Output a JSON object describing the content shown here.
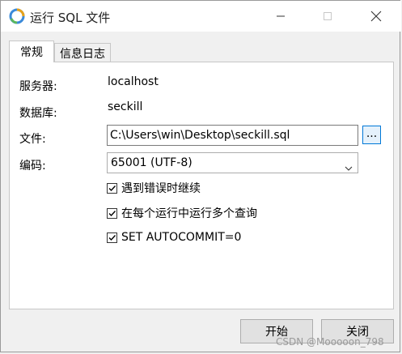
{
  "window": {
    "title": "运行 SQL 文件",
    "icons": {
      "app": "navicat-app-icon",
      "minimize": "minimize-icon",
      "maximize": "maximize-icon",
      "close": "close-icon"
    }
  },
  "tabs": [
    {
      "label": "常规",
      "active": true
    },
    {
      "label": "信息日志",
      "active": false
    }
  ],
  "general": {
    "server_label": "服务器:",
    "server_value": "localhost",
    "database_label": "数据库:",
    "database_value": "seckill",
    "file_label": "文件:",
    "file_value": "C:\\Users\\win\\Desktop\\seckill.sql",
    "browse_label": "...",
    "encoding_label": "编码:",
    "encoding_value": "65001 (UTF-8)",
    "options": [
      {
        "label": "遇到错误时继续",
        "checked": true
      },
      {
        "label": "在每个运行中运行多个查询",
        "checked": true
      },
      {
        "label": "SET AUTOCOMMIT=0",
        "checked": true
      }
    ]
  },
  "buttons": {
    "start": "开始",
    "close": "关闭"
  },
  "watermark": "CSDN @Mooooon_798",
  "colors": {
    "accent": "#0078d7",
    "title_text": "#222222"
  }
}
